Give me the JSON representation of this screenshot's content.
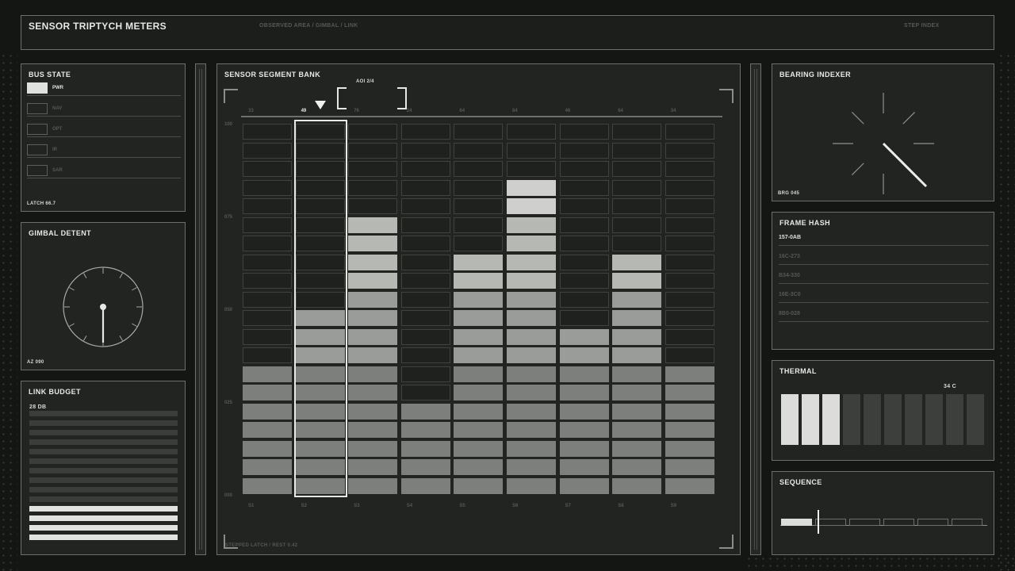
{
  "header": {
    "title": "SENSOR TRIPTYCH METERS",
    "center_label": "OBSERVED AREA / GIMBAL / LINK",
    "right_label": "STEP INDEX"
  },
  "bus_state": {
    "title": "BUS STATE",
    "items": [
      {
        "label": "PWR",
        "active": true
      },
      {
        "label": "NAV",
        "active": false
      },
      {
        "label": "OPT",
        "active": false
      },
      {
        "label": "IR",
        "active": false
      },
      {
        "label": "SAR",
        "active": false
      }
    ],
    "footer": "LATCH 66.7"
  },
  "gimbal": {
    "title": "GIMBAL DETENT",
    "footer": "AZ 090"
  },
  "link_budget": {
    "title": "LINK BUDGET",
    "value": "28 DB",
    "bars_total": 14,
    "bars_lit": 4
  },
  "segment_bank": {
    "title": "SENSOR SEGMENT BANK",
    "aoi_label": "AOI 2/4",
    "top_values": [
      "33",
      "49",
      "76",
      "24",
      "64",
      "84",
      "46",
      "64",
      "34"
    ],
    "y_ticks": [
      "100",
      "075",
      "050",
      "025",
      "000"
    ],
    "columns": [
      "S1",
      "S2",
      "S3",
      "S4",
      "S5",
      "S6",
      "S7",
      "S8",
      "S9"
    ],
    "levels": [
      7,
      10,
      15,
      5,
      13,
      17,
      9,
      13,
      7
    ],
    "rows": 20,
    "selected_index": 1,
    "footer": "STEPPED LATCH / REST 0.42"
  },
  "bearing": {
    "title": "BEARING INDEXER",
    "footer": "BRG 045"
  },
  "frame_hash": {
    "title": "FRAME HASH",
    "rows": [
      {
        "text": "157-0AB",
        "active": true
      },
      {
        "text": "16C-273",
        "active": false
      },
      {
        "text": "B34-330",
        "active": false
      },
      {
        "text": "16E-3C0",
        "active": false
      },
      {
        "text": "8B0-028",
        "active": false
      }
    ]
  },
  "thermal": {
    "title": "THERMAL",
    "value": "34 C",
    "cells_total": 10,
    "cells_lit": 3
  },
  "sequence": {
    "title": "SEQUENCE",
    "segments": 6,
    "progress_segments": 1
  }
}
